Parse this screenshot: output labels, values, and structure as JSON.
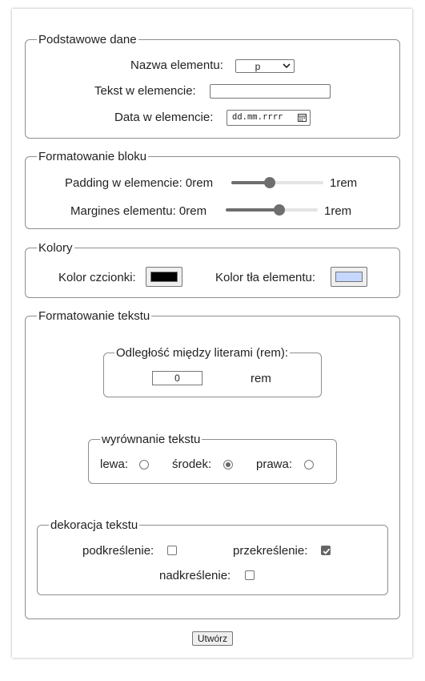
{
  "basic": {
    "legend": "Podstawowe dane",
    "element_label": "Nazwa elementu:",
    "element_value": "p",
    "text_label": "Tekst w elemencie:",
    "text_value": "",
    "date_label": "Data w elemencie:",
    "date_placeholder": "dd.mm.rrrr"
  },
  "block": {
    "legend": "Formatowanie bloku",
    "padding_label": "Padding w elemencie: 0rem",
    "padding_max": "1rem",
    "padding_level": 0.42,
    "margin_label": "Margines elementu: 0rem",
    "margin_max": "1rem",
    "margin_level": 0.58
  },
  "colors": {
    "legend": "Kolory",
    "font_label": "Kolor czcionki:",
    "font_color": "#000000",
    "bg_label": "Kolor tła elementu:",
    "bg_color": "#c5d6ff"
  },
  "text_format": {
    "legend": "Formatowanie tekstu",
    "spacing": {
      "legend": "Odległość między literami (rem):",
      "value": "0",
      "unit": "rem"
    },
    "align": {
      "legend": "wyrównanie tekstu",
      "left": "lewa:",
      "center": "środek:",
      "right": "prawa:",
      "selected": "center"
    },
    "decoration": {
      "legend": "dekoracja tekstu",
      "underline": "podkreślenie:",
      "underline_checked": false,
      "strike": "przekreślenie:",
      "strike_checked": true,
      "overline": "nadkreślenie:",
      "overline_checked": false
    }
  },
  "submit_label": "Utwórz"
}
